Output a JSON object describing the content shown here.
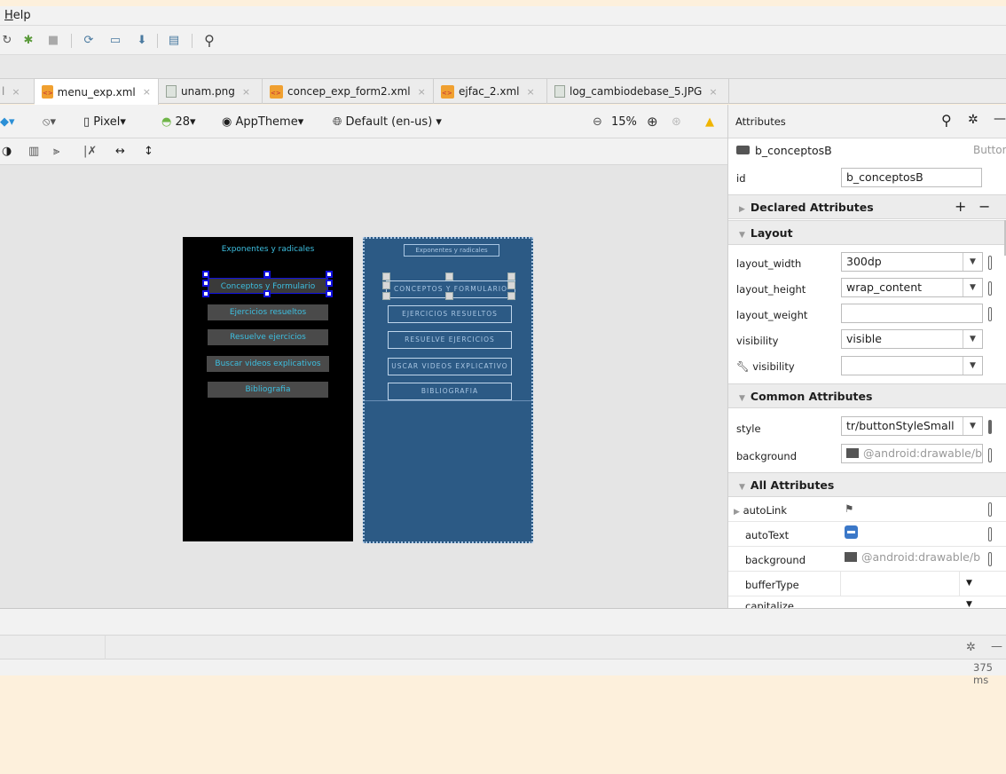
{
  "menu": {
    "help": "Help",
    "help_rest": "elp",
    "help_underline": "H"
  },
  "tabs": [
    {
      "label": "",
      "close": "×"
    },
    {
      "label": "menu_exp.xml",
      "close": "×"
    },
    {
      "label": "unam.png",
      "close": "×"
    },
    {
      "label": "concep_exp_form2.xml",
      "close": "×"
    },
    {
      "label": "ejfac_2.xml",
      "close": "×"
    },
    {
      "label": "log_cambiodebase_5.JPG",
      "close": "×"
    }
  ],
  "designbar": {
    "device": "Pixel",
    "api": "28",
    "theme": "AppTheme",
    "locale": "Default (en-us)",
    "zoom": "15%"
  },
  "phone": {
    "title": "Exponentes y radicales",
    "buttons": [
      "Conceptos y Formulario",
      "Ejercicios resueltos",
      "Resuelve ejercicios",
      "Buscar videos explicativos",
      "Bibliografia"
    ]
  },
  "blueprint": {
    "title": "Exponentes y radicales",
    "buttons": [
      "CONCEPTOS Y FORMULARIO",
      "EJERCICIOS RESUELTOS",
      "RESUELVE EJERCICIOS",
      "USCAR VIDEOS EXPLICATIVO",
      "BIBLIOGRAFIA"
    ]
  },
  "attributes": {
    "header": "Attributes",
    "component": "b_conceptosB",
    "component_type": "Button",
    "id_label": "id",
    "id_value": "b_conceptosB",
    "declared": "Declared Attributes",
    "layout": "Layout",
    "layout_width_label": "layout_width",
    "layout_width": "300dp",
    "layout_height_label": "layout_height",
    "layout_height": "wrap_content",
    "layout_weight_label": "layout_weight",
    "layout_weight": "",
    "visibility_label": "visibility",
    "visibility": "visible",
    "tools_visibility_label": "visibility",
    "tools_visibility": "",
    "common": "Common Attributes",
    "style_label": "style",
    "style": "tr/buttonStyleSmall",
    "background_label": "background",
    "background": "@android:drawable/b",
    "all": "All Attributes",
    "autolink_label": "autoLink",
    "autotext_label": "autoText",
    "background2_label": "background",
    "background2": "@android:drawable/b",
    "buffertype_label": "bufferType",
    "capitalize_label": "capitalize"
  },
  "status": {
    "time": "375 ms"
  },
  "colors": {
    "accent": "#3dbfe0",
    "blueprint": "#2c5a85",
    "warning": "#f0b400"
  },
  "icons": [
    "debug-icon",
    "stop-icon",
    "sync-icon",
    "avd-icon",
    "sdk-icon",
    "project-icon",
    "search-icon",
    "orientation-icon",
    "minus-circle-icon",
    "plus-circle-icon",
    "warning-icon",
    "gear-icon",
    "flag-icon",
    "image-icon"
  ]
}
